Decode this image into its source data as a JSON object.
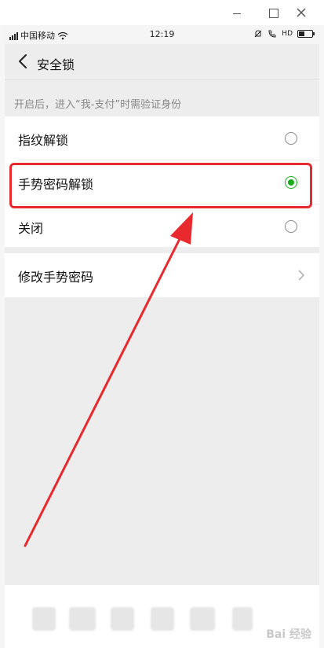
{
  "status_bar": {
    "carrier": "中国移动",
    "time": "12:19",
    "network": "HD"
  },
  "nav": {
    "title": "安全锁"
  },
  "hint": "开启后，进入“我-支付”时需验证身份",
  "options": [
    {
      "label": "指纹解锁",
      "selected": false
    },
    {
      "label": "手势密码解锁",
      "selected": true
    },
    {
      "label": "关闭",
      "selected": false
    }
  ],
  "actions": [
    {
      "label": "修改手势密码"
    }
  ],
  "watermark": "Bai 经验",
  "colors": {
    "accent": "#1aad19",
    "annotation": "#e8292d",
    "background": "#ededed"
  },
  "icons": {
    "back": "back-arrow-icon",
    "chevron": "chevron-right-icon",
    "wifi": "wifi-icon",
    "battery": "battery-icon"
  }
}
